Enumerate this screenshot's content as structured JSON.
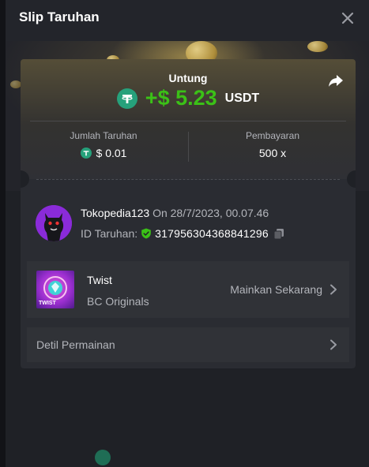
{
  "header": {
    "title": "Slip Taruhan"
  },
  "summary": {
    "label": "Untung",
    "amount": "+$ 5.23",
    "currency": "USDT"
  },
  "stats": {
    "bet_amount_label": "Jumlah Taruhan",
    "bet_amount_value": "$ 0.01",
    "payout_label": "Pembayaran",
    "payout_value": "500 x"
  },
  "user": {
    "name": "Tokopedia123",
    "date_text": "On 28/7/2023, 00.07.46",
    "bet_id_label": "ID Taruhan:",
    "bet_id_value": "317956304368841296"
  },
  "game": {
    "name": "Twist",
    "provider": "BC Originals",
    "play_label": "Mainkan Sekarang",
    "thumb_text": "TWIST"
  },
  "details": {
    "label": "Detil Permainan"
  },
  "colors": {
    "profit_green": "#3bc117",
    "tether_green": "#26a17b",
    "avatar_purple": "#8a2bd9"
  },
  "icons": {
    "close": "close-icon",
    "share": "share-icon",
    "tether": "tether-icon",
    "verified": "shield-check-icon",
    "copy": "copy-icon",
    "chevron": "chevron-right-icon"
  }
}
